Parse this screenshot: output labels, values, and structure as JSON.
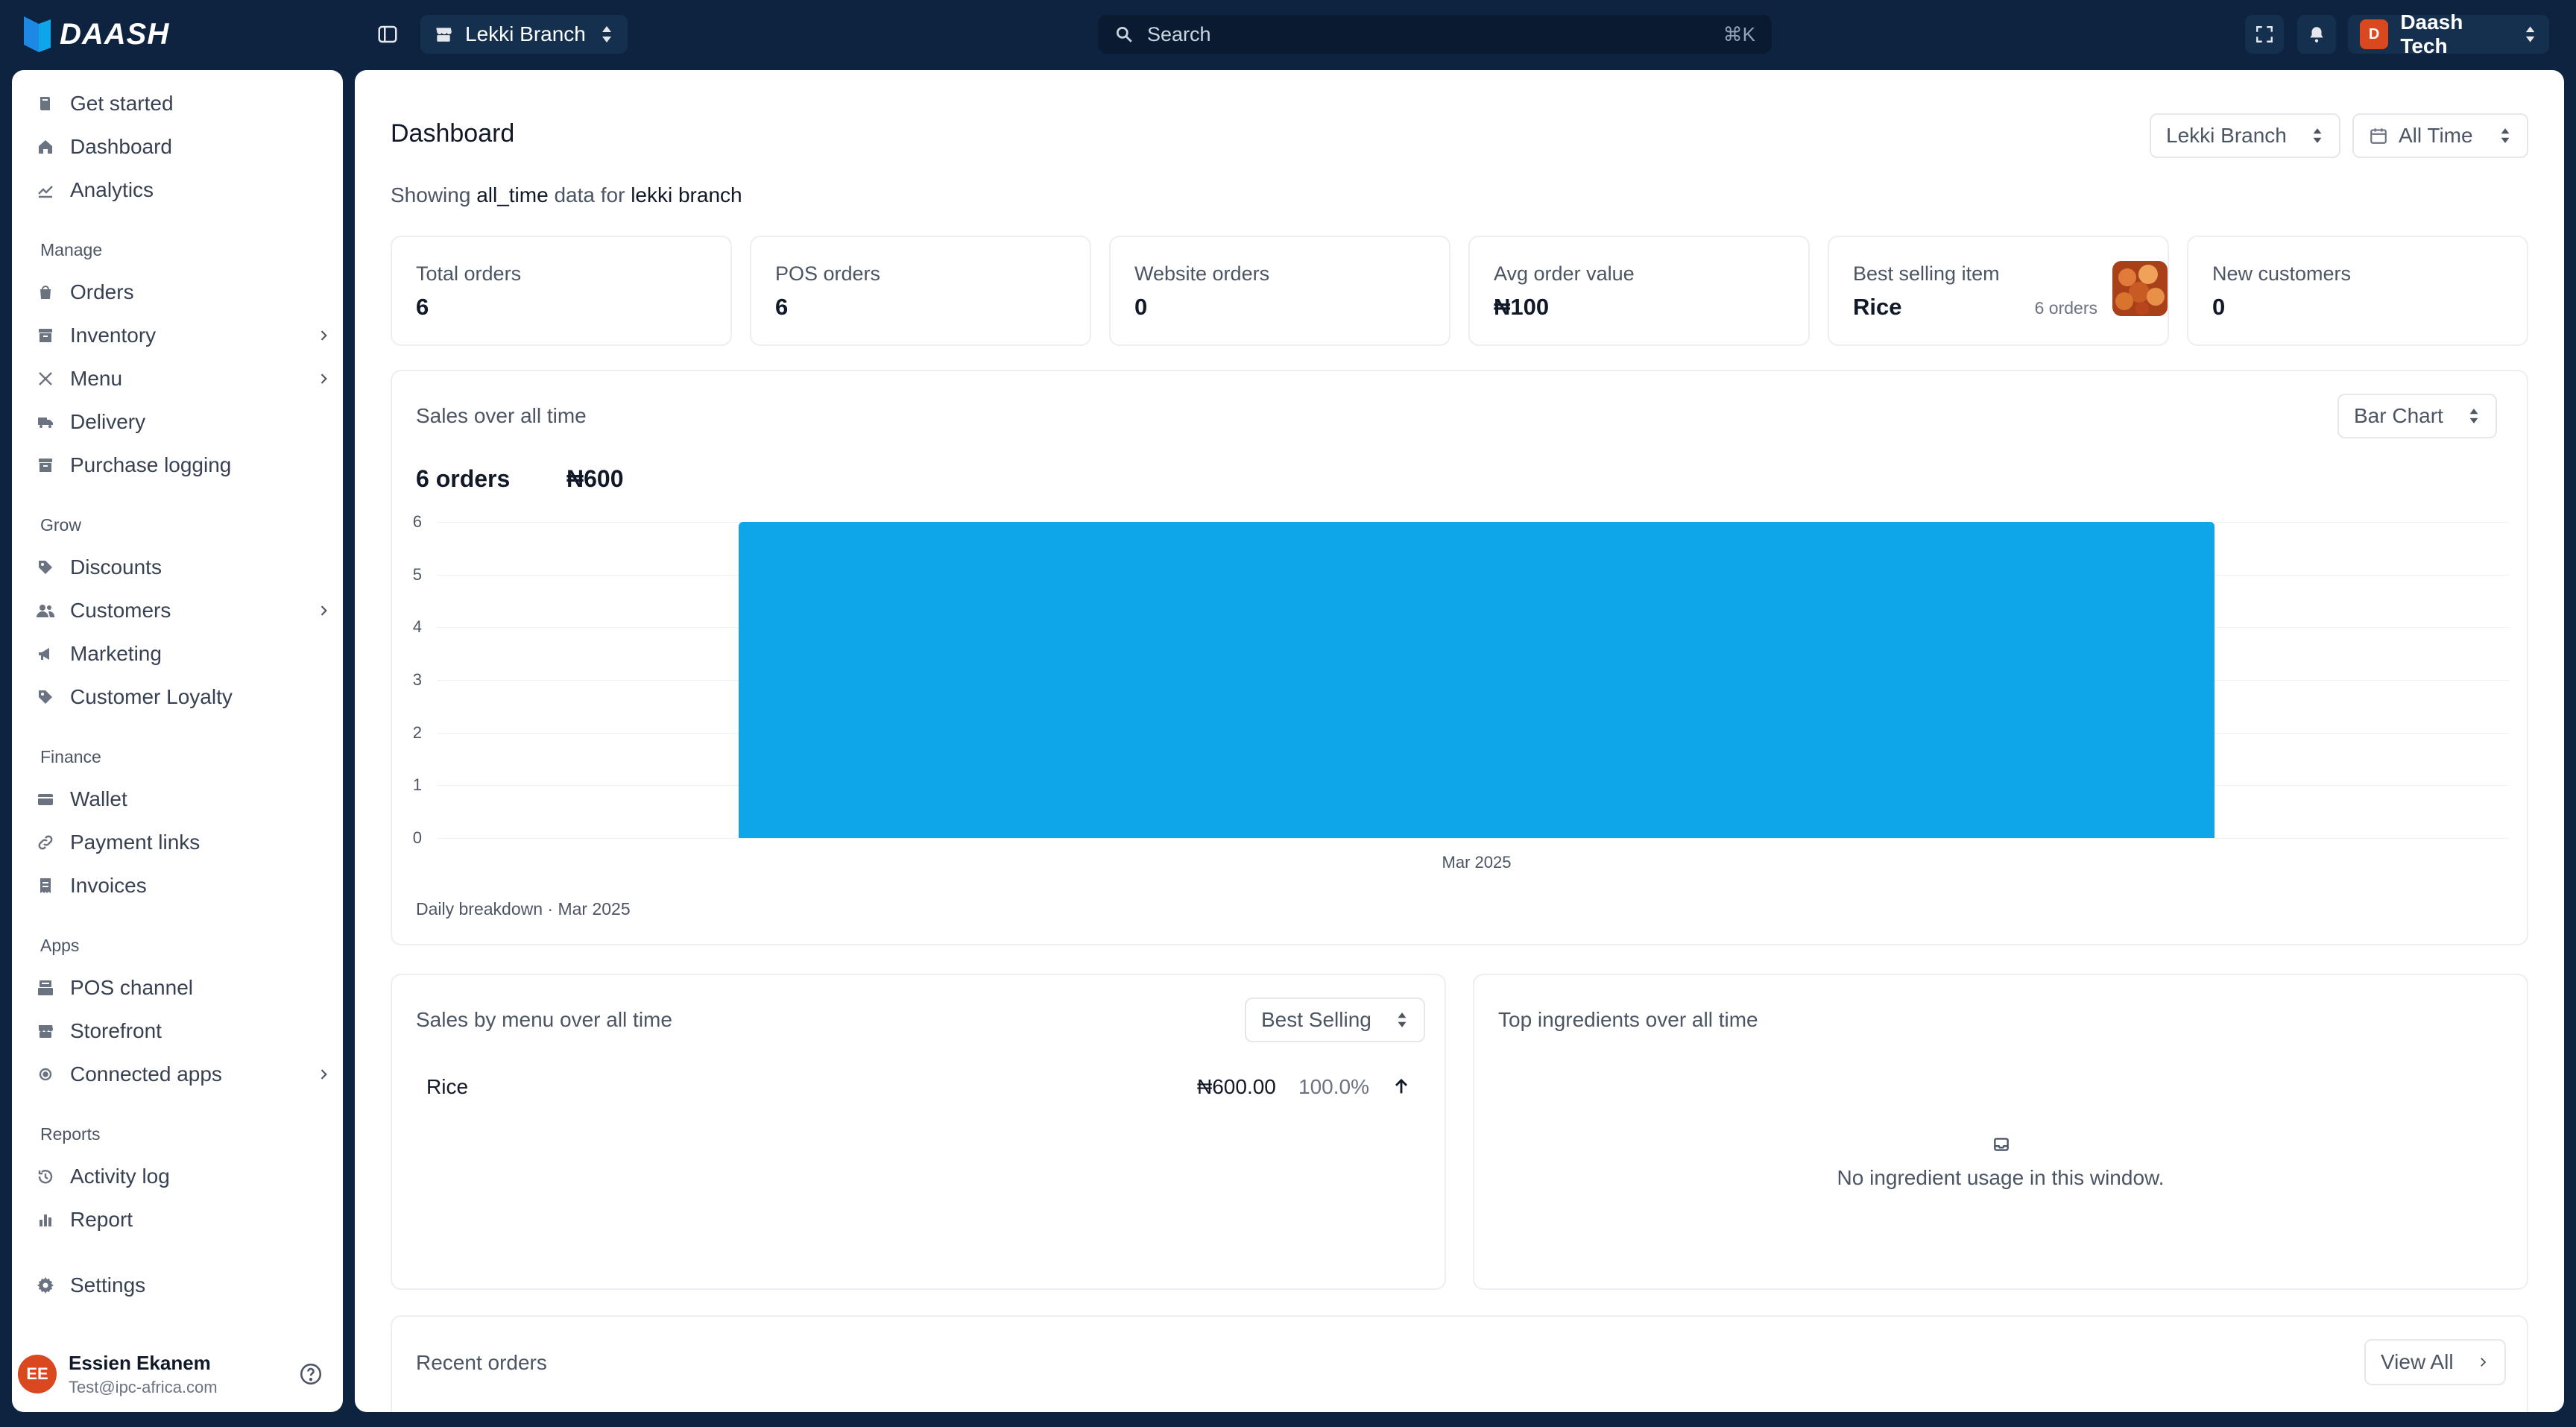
{
  "topbar": {
    "logo_text": "DAASH",
    "branch": "Lekki Branch",
    "search_placeholder": "Search",
    "search_shortcut": "⌘K",
    "org_initial": "D",
    "org_name": "Daash Tech"
  },
  "sidebar": {
    "top_items": [
      {
        "label": "Get started",
        "icon": "book-icon"
      },
      {
        "label": "Dashboard",
        "icon": "home-icon"
      },
      {
        "label": "Analytics",
        "icon": "analytics-icon"
      }
    ],
    "sections": [
      {
        "title": "Manage",
        "items": [
          {
            "label": "Orders",
            "icon": "bag-icon"
          },
          {
            "label": "Inventory",
            "icon": "archive-icon"
          },
          {
            "label": "Menu",
            "icon": "utensils-icon"
          },
          {
            "label": "Delivery",
            "icon": "truck-icon"
          },
          {
            "label": "Purchase logging",
            "icon": "archive-icon"
          }
        ]
      },
      {
        "title": "Grow",
        "items": [
          {
            "label": "Discounts",
            "icon": "tag-icon"
          },
          {
            "label": "Customers",
            "icon": "users-icon"
          },
          {
            "label": "Marketing",
            "icon": "megaphone-icon"
          },
          {
            "label": "Customer Loyalty",
            "icon": "tag-icon"
          }
        ]
      },
      {
        "title": "Finance",
        "items": [
          {
            "label": "Wallet",
            "icon": "wallet-icon"
          },
          {
            "label": "Payment links",
            "icon": "link-icon"
          },
          {
            "label": "Invoices",
            "icon": "receipt-icon"
          }
        ]
      },
      {
        "title": "Apps",
        "items": [
          {
            "label": "POS channel",
            "icon": "register-icon"
          },
          {
            "label": "Storefront",
            "icon": "store-icon"
          },
          {
            "label": "Connected apps",
            "icon": "puzzle-icon"
          }
        ]
      },
      {
        "title": "Reports",
        "items": [
          {
            "label": "Activity log",
            "icon": "history-icon"
          },
          {
            "label": "Report",
            "icon": "bar-chart-icon"
          }
        ]
      }
    ],
    "settings_label": "Settings",
    "user": {
      "initials": "EE",
      "name": "Essien Ekanem",
      "email": "Test@ipc-africa.com"
    }
  },
  "main": {
    "title": "Dashboard",
    "branch_filter": "Lekki Branch",
    "time_filter": "All Time",
    "showing": {
      "prefix": "Showing",
      "range": "all_time",
      "middle": "data for",
      "branch": "lekki branch"
    },
    "stats": [
      {
        "label": "Total orders",
        "value": "6"
      },
      {
        "label": "POS orders",
        "value": "6"
      },
      {
        "label": "Website orders",
        "value": "0"
      },
      {
        "label": "Avg order value",
        "value": "₦100"
      },
      {
        "label": "Best selling item",
        "value": "Rice",
        "extra": "6 orders"
      },
      {
        "label": "New customers",
        "value": "0"
      }
    ],
    "sales_card": {
      "title": "Sales over all time",
      "chart_type_select": "Bar Chart",
      "orders_summary": "6 orders",
      "amount_summary": "₦600",
      "caption": "Daily breakdown · Mar 2025"
    },
    "menu_card": {
      "title": "Sales by menu over all time",
      "sort_select": "Best Selling",
      "rows": [
        {
          "name": "Rice",
          "amount": "₦600.00",
          "percent": "100.0%"
        }
      ]
    },
    "ingredients_card": {
      "title": "Top ingredients over all time",
      "empty_message": "No ingredient usage in this window."
    },
    "recent_orders": {
      "title": "Recent orders",
      "view_all": "View All"
    }
  },
  "chart_data": {
    "type": "bar",
    "categories": [
      "Mar 2025"
    ],
    "values": [
      6
    ],
    "ylim": [
      0,
      6
    ],
    "yticks": [
      "0",
      "1",
      "2",
      "3",
      "4",
      "5",
      "6"
    ],
    "grid": true,
    "bar_color": "#0ea5e9"
  },
  "colors": {
    "topbar_bg": "#0e2340",
    "accent_blue": "#0ea5e9",
    "avatar_orange": "#d9481f"
  }
}
